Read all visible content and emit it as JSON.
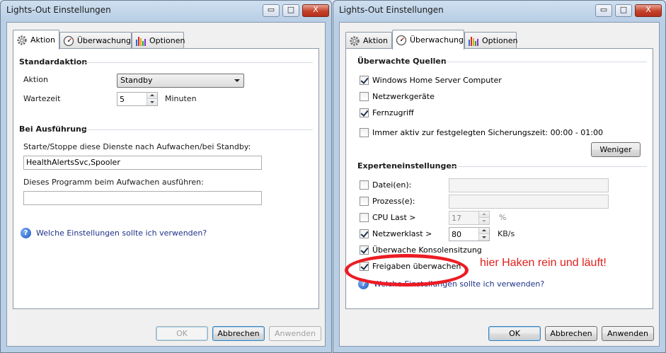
{
  "left_window": {
    "title": "Lights-Out Einstellungen",
    "controls": {
      "minimize": "▭",
      "maximize": "□",
      "close": "X"
    },
    "tabs": [
      {
        "label": "Aktion",
        "icon": "gear-icon",
        "active": true
      },
      {
        "label": "Überwachung",
        "icon": "gauge-icon",
        "active": false
      },
      {
        "label": "Optionen",
        "icon": "bar-chart-icon",
        "active": false
      }
    ],
    "standardaktion": {
      "title": "Standardaktion",
      "aktion_label": "Aktion",
      "aktion_value": "Standby",
      "wartezeit_label": "Wartezeit",
      "wartezeit_value": "5",
      "wartezeit_unit": "Minuten"
    },
    "ausfuehrung": {
      "title": "Bei Ausführung",
      "dienste_label": "Starte/Stoppe diese Dienste nach Aufwachen/bei Standby:",
      "dienste_value": "HealthAlertsSvc,Spooler",
      "programm_label": "Dieses Programm beim Aufwachen ausführen:",
      "programm_value": ""
    },
    "help_link": "Welche Einstellungen sollte ich verwenden?",
    "buttons": {
      "ok": "OK",
      "cancel": "Abbrechen",
      "apply": "Anwenden"
    }
  },
  "right_window": {
    "title": "Lights-Out Einstellungen",
    "controls": {
      "minimize": "▭",
      "maximize": "□",
      "close": "X"
    },
    "tabs": [
      {
        "label": "Aktion",
        "icon": "gear-icon",
        "active": false
      },
      {
        "label": "Überwachung",
        "icon": "gauge-icon",
        "active": true
      },
      {
        "label": "Optionen",
        "icon": "bar-chart-icon",
        "active": false
      }
    ],
    "quellen": {
      "title": "Überwachte Quellen",
      "items": [
        {
          "label": "Windows Home Server Computer",
          "checked": true
        },
        {
          "label": "Netzwerkgeräte",
          "checked": false
        },
        {
          "label": "Fernzugriff",
          "checked": true
        },
        {
          "label": "Immer aktiv zur festgelegten Sicherungszeit: 00:00 - 01:00",
          "checked": false
        }
      ],
      "weniger_button": "Weniger"
    },
    "experten": {
      "title": "Experteneinstellungen",
      "dateien_label": "Datei(en):",
      "dateien_checked": false,
      "prozess_label": "Prozess(e):",
      "prozess_checked": false,
      "cpu_label": "CPU Last >",
      "cpu_checked": false,
      "cpu_value": "17",
      "cpu_unit": "%",
      "netz_label": "Netzwerklast >",
      "netz_checked": true,
      "netz_value": "80",
      "netz_unit": "KB/s",
      "konsole_label": "Überwache Konsolensitzung",
      "konsole_checked": true,
      "freigaben_label": "Freigaben überwachen",
      "freigaben_checked": true
    },
    "help_link": "Welche Einstellungen sollte ich verwenden?",
    "annotation": "hier Haken rein und läuft!",
    "buttons": {
      "ok": "OK",
      "cancel": "Abbrechen",
      "apply": "Anwenden"
    }
  },
  "colors": {
    "annotation": "#e0201c",
    "link": "#1e3287",
    "window_frame": "#b9cfe6"
  }
}
